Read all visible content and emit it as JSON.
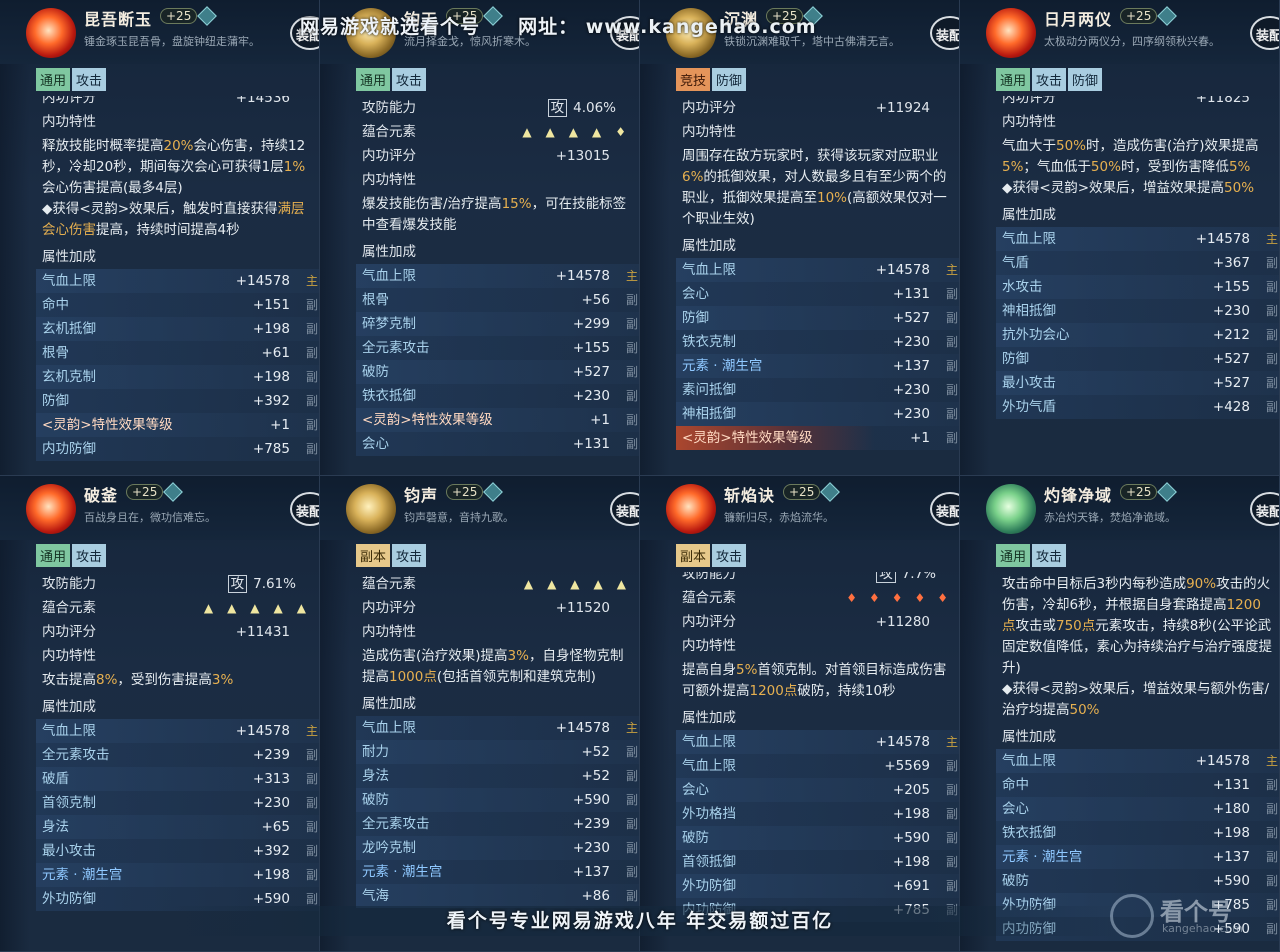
{
  "watermark_top": {
    "left": "网易游戏就选看个号",
    "url_label": "网址：",
    "url": "www.kangehao.com"
  },
  "watermark_bottom": "看个号专业网易游戏八年  年交易额过百亿",
  "logo": {
    "name": "看个号",
    "url": "kangehao.com"
  },
  "equip_label": "装配",
  "panels": [
    {
      "name": "昆吾断玉",
      "level": "+25",
      "motto": "锤金琢玉昆吾骨，盘旋钟纽走蒲牢。",
      "emblem": "red",
      "tags": [
        {
          "t": "通用",
          "c": "g"
        },
        {
          "t": "攻击",
          "c": "b"
        }
      ],
      "rows": [
        {
          "type": "lbl",
          "label": "内功评分",
          "value": "+14536",
          "cut": true
        },
        {
          "type": "lbl",
          "label": "内功特性"
        },
        {
          "type": "para",
          "text": "释放技能时概率提高20%会心伤害，持续12秒，冷却20秒，期间每次会心可获得1层1%会心伤害提高(最多4层)\n◆获得<灵韵>效果后，触发时直接获得满层会心伤害提高，持续时间提高4秒"
        },
        {
          "type": "lbl",
          "label": "属性加成"
        },
        {
          "type": "stat",
          "label": "气血上限",
          "value": "+14578",
          "side": "主"
        },
        {
          "type": "stat",
          "label": "命中",
          "value": "+151",
          "side": "副"
        },
        {
          "type": "stat",
          "label": "玄机抵御",
          "value": "+198",
          "side": "副"
        },
        {
          "type": "stat",
          "label": "根骨",
          "value": "+61",
          "side": "副"
        },
        {
          "type": "stat",
          "label": "玄机克制",
          "value": "+198",
          "side": "副"
        },
        {
          "type": "stat",
          "label": "防御",
          "value": "+392",
          "side": "副"
        },
        {
          "type": "rune",
          "label": "<灵韵>特性效果等级",
          "value": "+1",
          "side": "副"
        },
        {
          "type": "stat",
          "label": "内功防御",
          "value": "+785",
          "side": "副"
        }
      ]
    },
    {
      "name": "钧天",
      "level": "+25",
      "motto": "流月择金戈，惊风折寒木。",
      "emblem": "gold",
      "tags": [
        {
          "t": "通用",
          "c": "g"
        },
        {
          "t": "攻击",
          "c": "b"
        }
      ],
      "rows": [
        {
          "type": "attack",
          "label": "攻防能力",
          "box": "攻",
          "value": "4.06%"
        },
        {
          "type": "pips",
          "label": "蕴合元素",
          "pips": "▲▲▲▲♦"
        },
        {
          "type": "lbl",
          "label": "内功评分",
          "value": "+13015"
        },
        {
          "type": "lbl",
          "label": "内功特性"
        },
        {
          "type": "para",
          "text": "爆发技能伤害/治疗提高15%，可在技能标签中查看爆发技能"
        },
        {
          "type": "lbl",
          "label": "属性加成"
        },
        {
          "type": "stat",
          "label": "气血上限",
          "value": "+14578",
          "side": "主"
        },
        {
          "type": "stat",
          "label": "根骨",
          "value": "+56",
          "side": "副"
        },
        {
          "type": "stat",
          "label": "碎梦克制",
          "value": "+299",
          "side": "副"
        },
        {
          "type": "stat",
          "label": "全元素攻击",
          "value": "+155",
          "side": "副"
        },
        {
          "type": "stat",
          "label": "破防",
          "value": "+527",
          "side": "副"
        },
        {
          "type": "stat",
          "label": "铁衣抵御",
          "value": "+230",
          "side": "副"
        },
        {
          "type": "rune",
          "label": "<灵韵>特性效果等级",
          "value": "+1",
          "side": "副"
        },
        {
          "type": "stat",
          "label": "会心",
          "value": "+131",
          "side": "副"
        }
      ]
    },
    {
      "name": "沉渊",
      "level": "+25",
      "motto": "铁锁沉渊难取千，塔中古佛清无言。",
      "emblem": "gold",
      "tags": [
        {
          "t": "竞技",
          "c": "o"
        },
        {
          "t": "防御",
          "c": "b"
        }
      ],
      "rows": [
        {
          "type": "lbl",
          "label": "内功评分",
          "value": "+11924"
        },
        {
          "type": "lbl",
          "label": "内功特性"
        },
        {
          "type": "para",
          "text": "周围存在敌方玩家时，获得该玩家对应职业6%的抵御效果，对人数最多且有至少两个的职业，抵御效果提高至10%(高额效果仅对一个职业生效)"
        },
        {
          "type": "lbl",
          "label": "属性加成"
        },
        {
          "type": "stat",
          "label": "气血上限",
          "value": "+14578",
          "side": "主"
        },
        {
          "type": "stat",
          "label": "会心",
          "value": "+131",
          "side": "副"
        },
        {
          "type": "stat",
          "label": "防御",
          "value": "+527",
          "side": "副"
        },
        {
          "type": "stat",
          "label": "铁衣克制",
          "value": "+230",
          "side": "副"
        },
        {
          "type": "elem",
          "label": "元素 · 潮生宫",
          "value": "+137",
          "side": "副"
        },
        {
          "type": "stat",
          "label": "素问抵御",
          "value": "+230",
          "side": "副"
        },
        {
          "type": "stat",
          "label": "神相抵御",
          "value": "+230",
          "side": "副"
        },
        {
          "type": "rune",
          "label": "<灵韵>特性效果等级",
          "value": "+1",
          "side": "副"
        }
      ]
    },
    {
      "name": "日月两仪",
      "level": "+25",
      "motto": "太极动分两仪分，四序纲领秋兴春。",
      "emblem": "red",
      "tags": [
        {
          "t": "通用",
          "c": "g"
        },
        {
          "t": "攻击",
          "c": "b"
        },
        {
          "t": "防御",
          "c": "b"
        }
      ],
      "rows": [
        {
          "type": "lbl",
          "label": "内功评分",
          "value": "+11825",
          "cut": true
        },
        {
          "type": "lbl",
          "label": "内功特性"
        },
        {
          "type": "para",
          "text": "气血大于50%时，造成伤害(治疗)效果提高5%；气血低于50%时，受到伤害降低5%\n◆获得<灵韵>效果后，增益效果提高50%"
        },
        {
          "type": "lbl",
          "label": "属性加成"
        },
        {
          "type": "stat",
          "label": "气血上限",
          "value": "+14578",
          "side": "主"
        },
        {
          "type": "stat",
          "label": "气盾",
          "value": "+367",
          "side": "副"
        },
        {
          "type": "stat",
          "label": "水攻击",
          "value": "+155",
          "side": "副"
        },
        {
          "type": "stat",
          "label": "神相抵御",
          "value": "+230",
          "side": "副"
        },
        {
          "type": "stat",
          "label": "抗外功会心",
          "value": "+212",
          "side": "副"
        },
        {
          "type": "stat",
          "label": "防御",
          "value": "+527",
          "side": "副"
        },
        {
          "type": "stat",
          "label": "最小攻击",
          "value": "+527",
          "side": "副"
        },
        {
          "type": "stat",
          "label": "外功气盾",
          "value": "+428",
          "side": "副"
        }
      ]
    },
    {
      "name": "破釜",
      "level": "+25",
      "motto": "百战身且在，微功信难忘。",
      "emblem": "red",
      "tags": [
        {
          "t": "通用",
          "c": "g"
        },
        {
          "t": "攻击",
          "c": "b"
        }
      ],
      "rows": [
        {
          "type": "attack",
          "label": "攻防能力",
          "box": "攻",
          "value": "7.61%"
        },
        {
          "type": "pips",
          "label": "蕴合元素",
          "pips": "▲▲▲▲▲"
        },
        {
          "type": "lbl",
          "label": "内功评分",
          "value": "+11431"
        },
        {
          "type": "lbl",
          "label": "内功特性"
        },
        {
          "type": "para",
          "text": "攻击提高8%，受到伤害提高3%"
        },
        {
          "type": "lbl",
          "label": "属性加成"
        },
        {
          "type": "stat",
          "label": "气血上限",
          "value": "+14578",
          "side": "主"
        },
        {
          "type": "stat",
          "label": "全元素攻击",
          "value": "+239",
          "side": "副"
        },
        {
          "type": "stat",
          "label": "破盾",
          "value": "+313",
          "side": "副"
        },
        {
          "type": "stat",
          "label": "首领克制",
          "value": "+230",
          "side": "副"
        },
        {
          "type": "stat",
          "label": "身法",
          "value": "+65",
          "side": "副"
        },
        {
          "type": "stat",
          "label": "最小攻击",
          "value": "+392",
          "side": "副"
        },
        {
          "type": "elem",
          "label": "元素 · 潮生宫",
          "value": "+198",
          "side": "副"
        },
        {
          "type": "stat",
          "label": "外功防御",
          "value": "+590",
          "side": "副"
        }
      ]
    },
    {
      "name": "钧声",
      "level": "+25",
      "motto": "钧声磬意，音持九歌。",
      "emblem": "gold",
      "tags": [
        {
          "t": "副本",
          "c": "y"
        },
        {
          "t": "攻击",
          "c": "b"
        }
      ],
      "rows": [
        {
          "type": "pips",
          "label": "蕴合元素",
          "pips": "▲▲▲▲▲"
        },
        {
          "type": "lbl",
          "label": "内功评分",
          "value": "+11520"
        },
        {
          "type": "lbl",
          "label": "内功特性"
        },
        {
          "type": "para",
          "text": "造成伤害(治疗效果)提高3%，自身怪物克制提高1000点(包括首领克制和建筑克制)"
        },
        {
          "type": "lbl",
          "label": "属性加成"
        },
        {
          "type": "stat",
          "label": "气血上限",
          "value": "+14578",
          "side": "主"
        },
        {
          "type": "stat",
          "label": "耐力",
          "value": "+52",
          "side": "副"
        },
        {
          "type": "stat",
          "label": "身法",
          "value": "+52",
          "side": "副"
        },
        {
          "type": "stat",
          "label": "破防",
          "value": "+590",
          "side": "副"
        },
        {
          "type": "stat",
          "label": "全元素攻击",
          "value": "+239",
          "side": "副"
        },
        {
          "type": "stat",
          "label": "龙吟克制",
          "value": "+230",
          "side": "副"
        },
        {
          "type": "elem",
          "label": "元素 · 潮生宫",
          "value": "+137",
          "side": "副"
        },
        {
          "type": "stat",
          "label": "气海",
          "value": "+86",
          "side": "副"
        }
      ]
    },
    {
      "name": "斩焰诀",
      "level": "+25",
      "motto": "镰新归尽，赤焰流华。",
      "emblem": "red",
      "tags": [
        {
          "t": "副本",
          "c": "y"
        },
        {
          "t": "攻击",
          "c": "b"
        }
      ],
      "rows": [
        {
          "type": "attack",
          "label": "攻防能力",
          "box": "攻",
          "value": "7.7%",
          "cut": true
        },
        {
          "type": "pips",
          "label": "蕴合元素",
          "pips": "♦♦♦♦♦",
          "red": true
        },
        {
          "type": "lbl",
          "label": "内功评分",
          "value": "+11280"
        },
        {
          "type": "lbl",
          "label": "内功特性"
        },
        {
          "type": "para",
          "text": "提高自身5%首领克制。对首领目标造成伤害可额外提高1200点破防，持续10秒"
        },
        {
          "type": "lbl",
          "label": "属性加成"
        },
        {
          "type": "stat",
          "label": "气血上限",
          "value": "+14578",
          "side": "主"
        },
        {
          "type": "stat",
          "label": "气血上限",
          "value": "+5569",
          "side": "副"
        },
        {
          "type": "stat",
          "label": "会心",
          "value": "+205",
          "side": "副"
        },
        {
          "type": "stat",
          "label": "外功格挡",
          "value": "+198",
          "side": "副"
        },
        {
          "type": "stat",
          "label": "破防",
          "value": "+590",
          "side": "副"
        },
        {
          "type": "stat",
          "label": "首领抵御",
          "value": "+198",
          "side": "副"
        },
        {
          "type": "stat",
          "label": "外功防御",
          "value": "+691",
          "side": "副"
        },
        {
          "type": "stat",
          "label": "内功防御",
          "value": "+785",
          "side": "副"
        }
      ]
    },
    {
      "name": "灼锋净域",
      "level": "+25",
      "motto": "赤冶灼天锋，焚焰净诡域。",
      "emblem": "green",
      "tags": [
        {
          "t": "通用",
          "c": "g"
        },
        {
          "t": "攻击",
          "c": "b"
        }
      ],
      "rows": [
        {
          "type": "para",
          "text": "攻击命中目标后3秒内每秒造成90%攻击的火伤害，冷却6秒，并根据自身套路提高1200点攻击或750点元素攻击，持续8秒(公平论武固定数值降低，素心为持续治疗与治疗强度提升)\n◆获得<灵韵>效果后，增益效果与额外伤害/治疗均提高50%"
        },
        {
          "type": "lbl",
          "label": "属性加成"
        },
        {
          "type": "stat",
          "label": "气血上限",
          "value": "+14578",
          "side": "主"
        },
        {
          "type": "stat",
          "label": "命中",
          "value": "+131",
          "side": "副"
        },
        {
          "type": "stat",
          "label": "会心",
          "value": "+180",
          "side": "副"
        },
        {
          "type": "stat",
          "label": "铁衣抵御",
          "value": "+198",
          "side": "副"
        },
        {
          "type": "elem",
          "label": "元素 · 潮生宫",
          "value": "+137",
          "side": "副"
        },
        {
          "type": "stat",
          "label": "破防",
          "value": "+590",
          "side": "副"
        },
        {
          "type": "stat",
          "label": "外功防御",
          "value": "+785",
          "side": "副"
        },
        {
          "type": "stat",
          "label": "内功防御",
          "value": "+590",
          "side": "副"
        }
      ]
    }
  ]
}
